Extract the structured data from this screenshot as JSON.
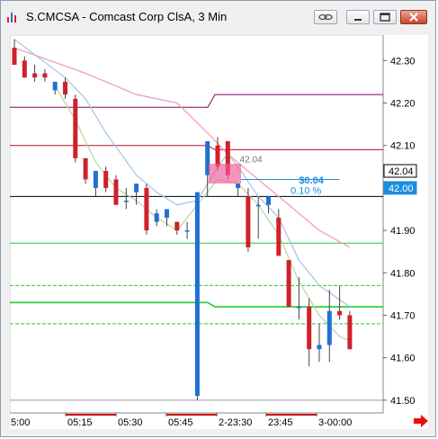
{
  "window": {
    "title": "S.CMCSA - Comcast Corp ClsA, 3 Min",
    "icons": [
      "chart-app-icon",
      "link-icon",
      "minimize-icon",
      "maximize-icon",
      "close-icon"
    ]
  },
  "colors": {
    "up": "#1f6fd6",
    "down": "#d0202a",
    "ma_pink": "#f0a0b8",
    "ma_blue": "#a8c8e8",
    "ma_green": "#b9d8a8",
    "price_box": "#1a8fe0",
    "purple_line": "#800060",
    "darkred_line": "#b01020",
    "green_line": "#22cc33"
  },
  "chart_data": {
    "type": "candlestick",
    "y_ticks": [
      "42.30",
      "42.20",
      "42.10",
      "42.00",
      "41.90",
      "41.80",
      "41.70",
      "41.60",
      "41.50"
    ],
    "ylim": [
      41.47,
      42.36
    ],
    "x_ticks": [
      "5:00",
      "05:15",
      "05:30",
      "05:45",
      "2-23:30",
      "23:45",
      "3-00:00"
    ],
    "price_labels": {
      "current": "42.04",
      "cursor": "42.00"
    },
    "measure": {
      "value": "$0.04",
      "percent": "0.10 %",
      "level": "42.04"
    },
    "candles": [
      {
        "o": 42.33,
        "h": 42.35,
        "l": 42.29,
        "c": 42.29
      },
      {
        "o": 42.3,
        "h": 42.31,
        "l": 42.26,
        "c": 42.26
      },
      {
        "o": 42.27,
        "h": 42.29,
        "l": 42.25,
        "c": 42.26
      },
      {
        "o": 42.27,
        "h": 42.28,
        "l": 42.25,
        "c": 42.26
      },
      {
        "o": 42.23,
        "h": 42.25,
        "l": 42.22,
        "c": 42.25
      },
      {
        "o": 42.25,
        "h": 42.26,
        "l": 42.21,
        "c": 42.22
      },
      {
        "o": 42.21,
        "h": 42.22,
        "l": 42.06,
        "c": 42.07
      },
      {
        "o": 42.07,
        "h": 42.07,
        "l": 42.01,
        "c": 42.02
      },
      {
        "o": 42.0,
        "h": 42.04,
        "l": 41.98,
        "c": 42.04
      },
      {
        "o": 42.04,
        "h": 42.05,
        "l": 41.99,
        "c": 42.0
      },
      {
        "o": 42.02,
        "h": 42.03,
        "l": 41.96,
        "c": 41.96
      },
      {
        "o": 41.97,
        "h": 42.0,
        "l": 41.95,
        "c": 41.97
      },
      {
        "o": 41.99,
        "h": 42.01,
        "l": 41.96,
        "c": 42.01
      },
      {
        "o": 42.0,
        "h": 42.01,
        "l": 41.89,
        "c": 41.9
      },
      {
        "o": 41.92,
        "h": 41.95,
        "l": 41.91,
        "c": 41.94
      },
      {
        "o": 41.93,
        "h": 41.95,
        "l": 41.91,
        "c": 41.95
      },
      {
        "o": 41.92,
        "h": 41.92,
        "l": 41.89,
        "c": 41.9
      },
      {
        "o": 41.9,
        "h": 41.92,
        "l": 41.88,
        "c": 41.9
      },
      {
        "o": 41.51,
        "h": 41.99,
        "l": 41.5,
        "c": 41.99
      },
      {
        "o": 42.03,
        "h": 42.11,
        "l": 41.98,
        "c": 42.11
      },
      {
        "o": 42.1,
        "h": 42.12,
        "l": 42.04,
        "c": 42.05
      },
      {
        "o": 42.11,
        "h": 42.11,
        "l": 42.02,
        "c": 42.03
      },
      {
        "o": 42.0,
        "h": 42.01,
        "l": 41.98,
        "c": 42.01
      },
      {
        "o": 41.98,
        "h": 42.0,
        "l": 41.85,
        "c": 41.86
      },
      {
        "o": 41.96,
        "h": 41.98,
        "l": 41.88,
        "c": 41.96
      },
      {
        "o": 41.96,
        "h": 41.98,
        "l": 41.94,
        "c": 41.98
      },
      {
        "o": 41.93,
        "h": 41.95,
        "l": 41.84,
        "c": 41.84
      },
      {
        "o": 41.83,
        "h": 41.83,
        "l": 41.72,
        "c": 41.72
      },
      {
        "o": 41.72,
        "h": 41.79,
        "l": 41.69,
        "c": 41.72
      },
      {
        "o": 41.72,
        "h": 41.74,
        "l": 41.58,
        "c": 41.62
      },
      {
        "o": 41.62,
        "h": 41.68,
        "l": 41.59,
        "c": 41.63
      },
      {
        "o": 41.63,
        "h": 41.76,
        "l": 41.59,
        "c": 41.71
      },
      {
        "o": 41.71,
        "h": 41.77,
        "l": 41.69,
        "c": 41.7
      },
      {
        "o": 41.7,
        "h": 41.71,
        "l": 41.62,
        "c": 41.62
      }
    ],
    "ma_pink": [
      [
        0,
        42.33
      ],
      [
        7,
        42.27
      ],
      [
        12,
        42.22
      ],
      [
        16,
        42.2
      ],
      [
        19,
        42.13
      ],
      [
        21,
        42.08
      ],
      [
        24,
        42.02
      ],
      [
        27,
        41.96
      ],
      [
        30,
        41.9
      ],
      [
        33,
        41.86
      ]
    ],
    "ma_blue": [
      [
        0,
        42.35
      ],
      [
        5,
        42.26
      ],
      [
        7,
        42.21
      ],
      [
        9,
        42.13
      ],
      [
        12,
        42.03
      ],
      [
        14,
        41.99
      ],
      [
        16,
        41.96
      ],
      [
        18,
        41.97
      ],
      [
        20,
        42.05
      ],
      [
        21,
        42.08
      ],
      [
        22,
        42.05
      ],
      [
        24,
        41.98
      ],
      [
        26,
        41.93
      ],
      [
        28,
        41.83
      ],
      [
        30,
        41.77
      ],
      [
        33,
        41.72
      ]
    ],
    "ma_green": [
      [
        4,
        42.24
      ],
      [
        6,
        42.16
      ],
      [
        8,
        42.06
      ],
      [
        10,
        42.0
      ],
      [
        12,
        41.97
      ],
      [
        14,
        41.93
      ],
      [
        16,
        41.9
      ],
      [
        18,
        41.96
      ],
      [
        20,
        42.02
      ],
      [
        22,
        42.01
      ],
      [
        24,
        41.96
      ],
      [
        26,
        41.89
      ],
      [
        28,
        41.78
      ],
      [
        30,
        41.7
      ],
      [
        32,
        41.65
      ],
      [
        33,
        41.64
      ]
    ],
    "levels": [
      {
        "y": 42.19,
        "x0": 0,
        "x1": 1.0,
        "color": "purple",
        "style": "solid",
        "y_right": 42.22
      },
      {
        "y": 42.1,
        "x0": 0,
        "x1": 1.0,
        "color": "darkred",
        "style": "solid",
        "y_right": 42.09
      },
      {
        "y": 41.98,
        "x0": 0,
        "x1": 1.0,
        "color": "black",
        "style": "solid",
        "y_right": 41.98
      },
      {
        "y": 41.87,
        "x0": 0,
        "x1": 1.0,
        "color": "green",
        "style": "solid",
        "y_right": 41.87
      },
      {
        "y": 41.77,
        "x0": 0,
        "x1": 1.0,
        "color": "green",
        "style": "dashed",
        "y_right": 41.77
      },
      {
        "y": 41.73,
        "x0": 0,
        "x1": 1.0,
        "color": "green",
        "style": "solid",
        "y_right": 41.72
      },
      {
        "y": 41.68,
        "x0": 0,
        "x1": 1.0,
        "color": "green",
        "style": "dashed",
        "y_right": 41.68
      },
      {
        "y": 41.5,
        "x0": 0,
        "x1": 1.0,
        "color": "gray",
        "style": "solid",
        "y_right": 41.5
      }
    ]
  }
}
